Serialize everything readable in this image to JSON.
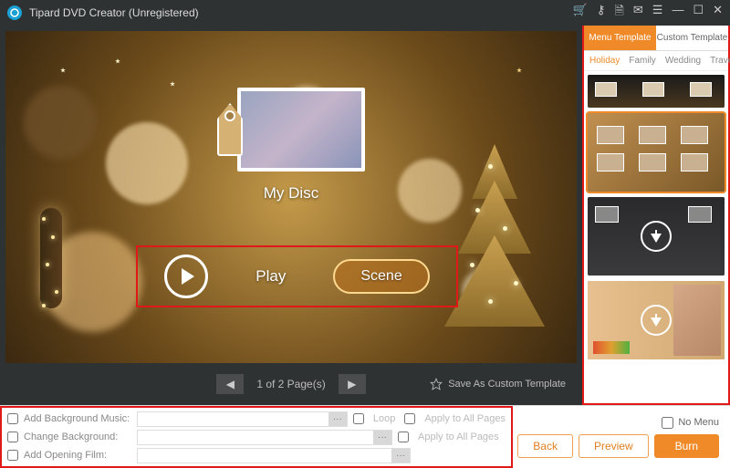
{
  "titlebar": {
    "title": "Tipard DVD Creator (Unregistered)"
  },
  "disc": {
    "title": "My Disc",
    "play": "Play",
    "scene": "Scene"
  },
  "pager": {
    "text": "1 of 2 Page(s)"
  },
  "saveas": "Save As Custom Template",
  "tabs": {
    "menu": "Menu Template",
    "custom": "Custom Template"
  },
  "categories": [
    "Holiday",
    "Family",
    "Wedding",
    "Travel"
  ],
  "options": {
    "bgm": "Add Background Music:",
    "bg": "Change Background:",
    "film": "Add Opening Film:",
    "loop": "Loop",
    "applyAll": "Apply to All Pages"
  },
  "buttons": {
    "nomenu": "No Menu",
    "back": "Back",
    "preview": "Preview",
    "burn": "Burn"
  }
}
